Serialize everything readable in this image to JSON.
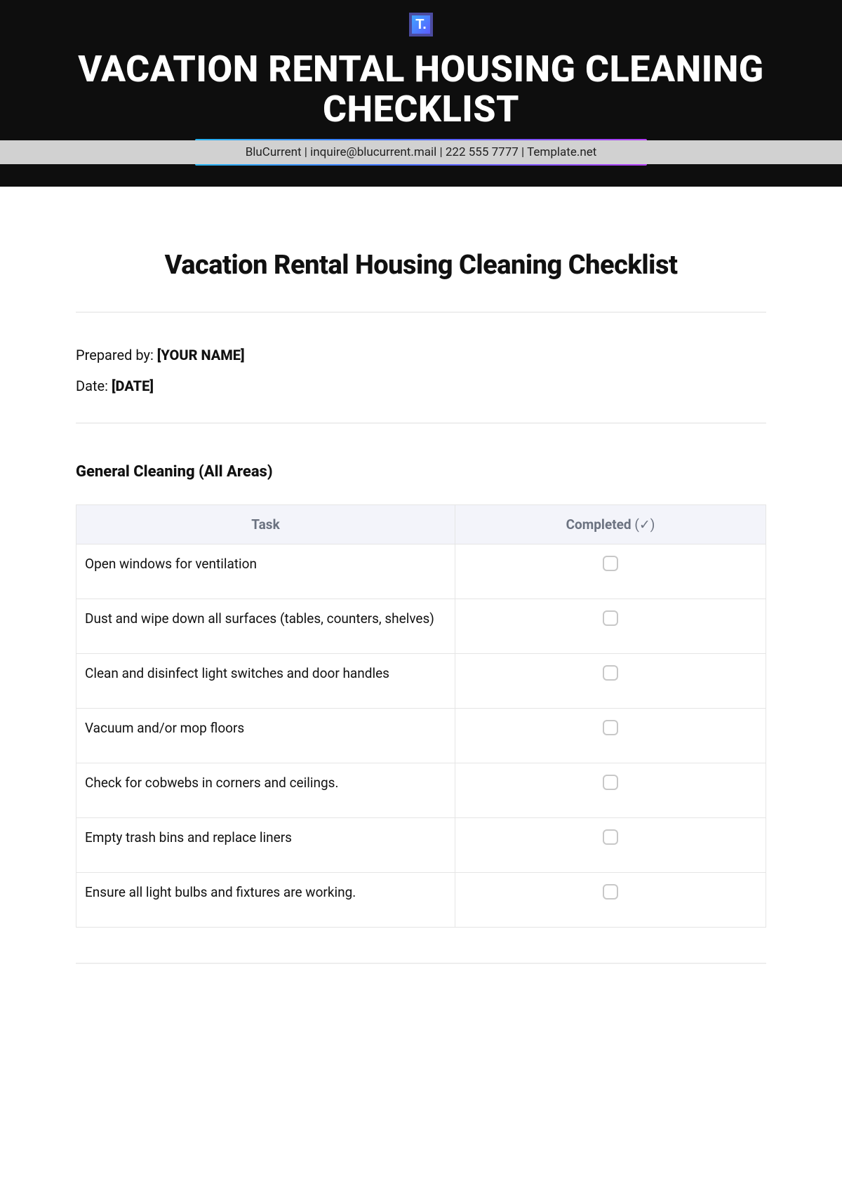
{
  "banner": {
    "logo_letter": "T.",
    "title": "VACATION RENTAL HOUSING CLEANING CHECKLIST",
    "info": "BluCurrent | inquire@blucurrent.mail | 222 555 7777 | Template.net"
  },
  "doc": {
    "title": "Vacation Rental Housing Cleaning Checklist",
    "prepared_by_label": "Prepared by: ",
    "prepared_by_value": "[YOUR NAME]",
    "date_label": "Date: ",
    "date_value": "[DATE]"
  },
  "section": {
    "title": "General Cleaning (All Areas)",
    "col_task": "Task",
    "col_completed_a": "Completed ",
    "col_completed_b": "(✓)",
    "tasks": {
      "0": "Open windows for ventilation",
      "1": "Dust and wipe down all surfaces (tables, counters, shelves)",
      "2": "Clean and disinfect light switches and door handles",
      "3": "Vacuum and/or mop floors",
      "4": "Check for cobwebs in corners and ceilings.",
      "5": "Empty trash bins and replace liners",
      "6": "Ensure all light bulbs and fixtures are working."
    }
  }
}
